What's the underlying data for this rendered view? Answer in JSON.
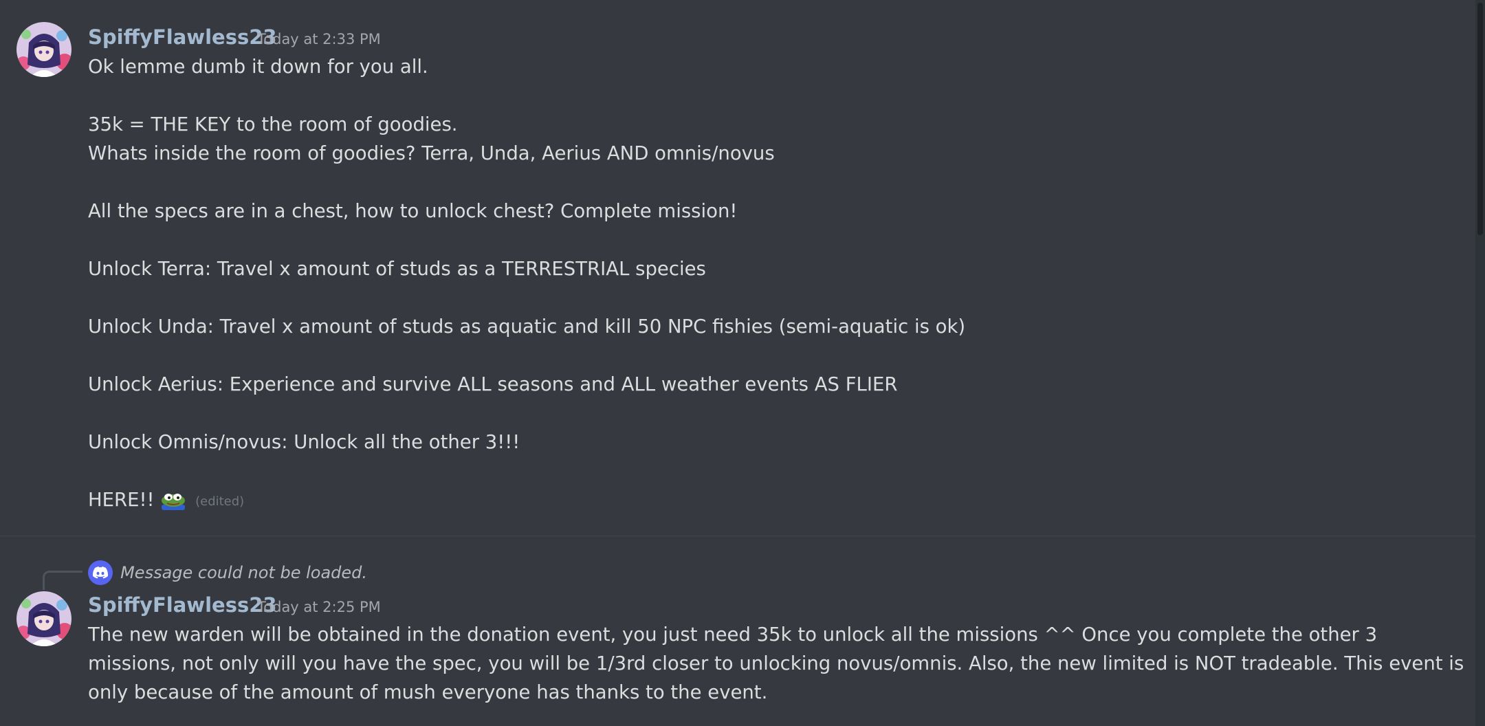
{
  "messages": [
    {
      "author": "SpiffyFlawless23",
      "timestamp": "Today at 2:33 PM",
      "lines": [
        "Ok lemme dumb it down for you all.",
        "",
        "35k = THE KEY to the room of goodies.",
        "Whats inside the room of goodies? Terra, Unda, Aerius AND omnis/novus",
        "",
        "All the specs are in a chest, how to unlock chest? Complete mission!",
        "",
        "Unlock Terra: Travel x amount of studs as a TERRESTRIAL species",
        "",
        "Unlock Unda: Travel x amount of studs as aquatic and kill 50 NPC fishies (semi-aquatic is ok)",
        "",
        "Unlock Aerius: Experience and survive ALL seasons and ALL weather events AS FLIER",
        "",
        "Unlock Omnis/novus: Unlock all the other 3!!!",
        ""
      ],
      "last_line": "HERE!!",
      "emoji": "pepe-frog-emoji",
      "edited_label": "(edited)"
    },
    {
      "reply_text": "Message could not be loaded.",
      "reply_icon": "discord-icon",
      "author": "SpiffyFlawless23",
      "timestamp": "Today at 2:25 PM",
      "text": "The new warden will be obtained in the donation event, you just need 35k to unlock all the missions ^^ Once you complete the other 3 missions, not only will you have the spec, you will be 1/3rd closer to unlocking novus/omnis. Also, the new limited is NOT tradeable. This event is only because of the amount of mush everyone has thanks to the event."
    }
  ],
  "colors": {
    "background": "#36393f",
    "username": "#a3b9d0",
    "timestamp": "#a3a6aa",
    "text": "#dcddde",
    "reply_icon_bg": "#5865f2"
  }
}
